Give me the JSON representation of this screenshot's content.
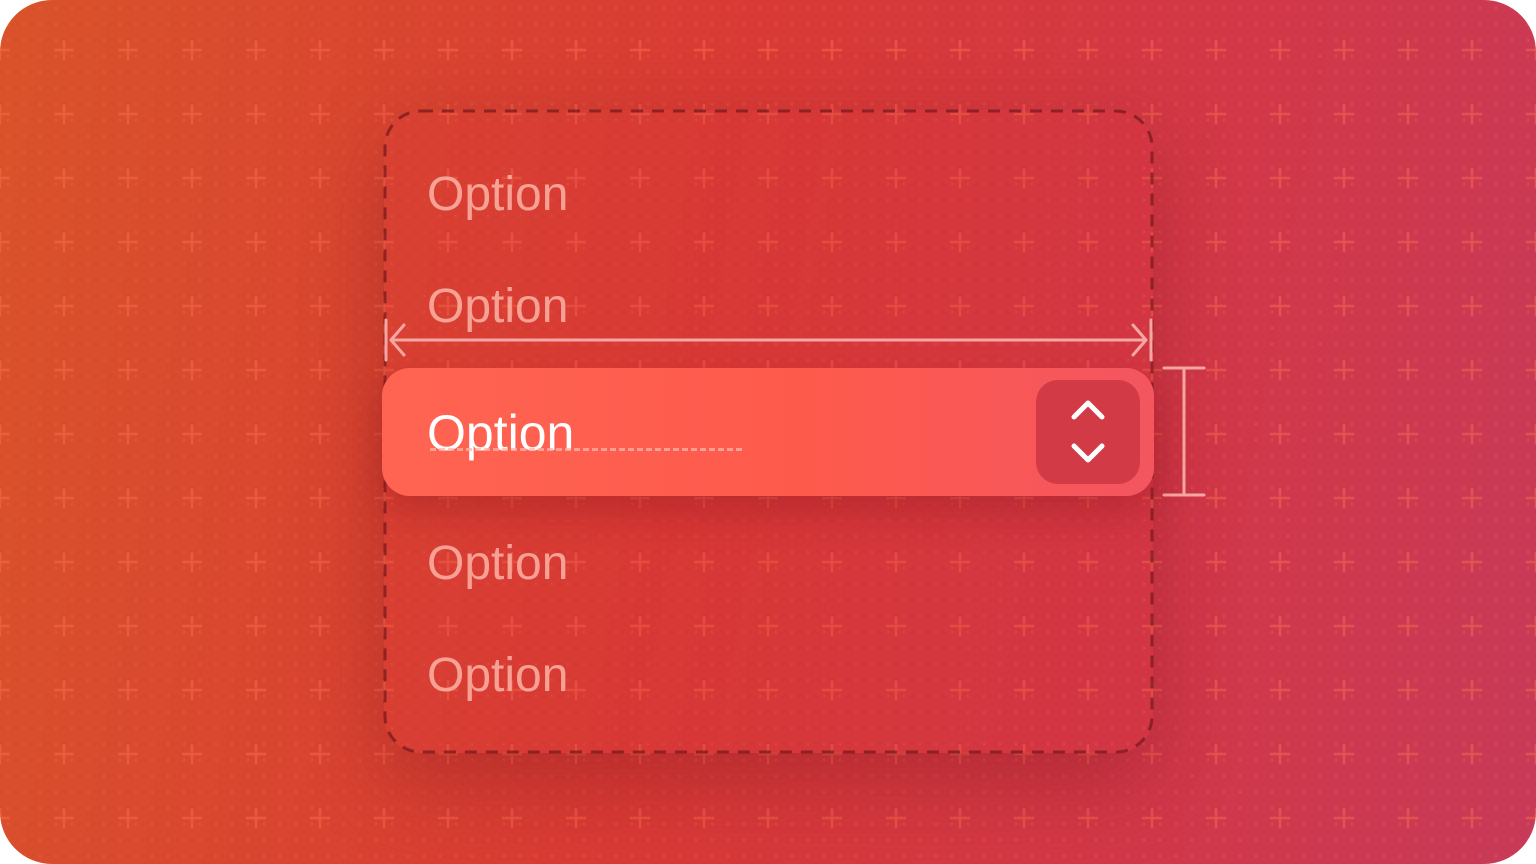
{
  "colors": {
    "background_start": "#d9532a",
    "background_end": "#c83a58",
    "control_fill": "#fe5a4c",
    "stepper_fill": "#d23a45",
    "guide_stroke": "#f6a7a4"
  },
  "menu": {
    "options": [
      {
        "label": "Option"
      },
      {
        "label": "Option"
      },
      {
        "label": "Option"
      },
      {
        "label": "Option"
      }
    ]
  },
  "select": {
    "value": "Option",
    "stepper_icons": [
      "chevron-up-icon",
      "chevron-down-icon"
    ]
  }
}
